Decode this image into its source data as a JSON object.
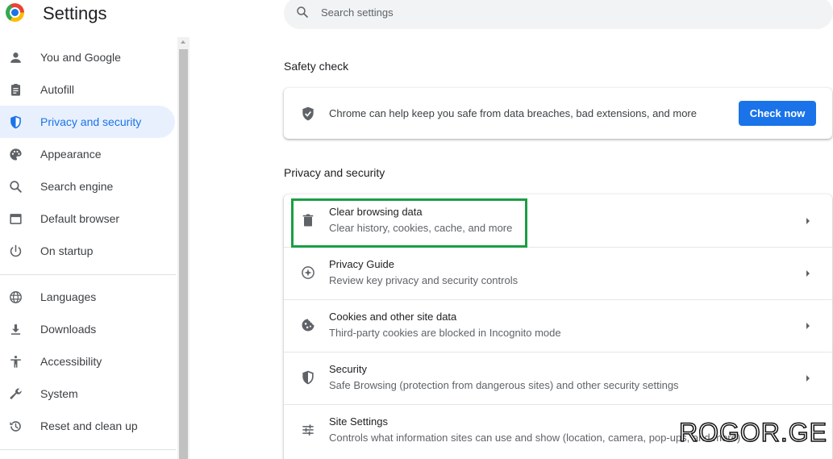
{
  "header": {
    "title": "Settings",
    "search_placeholder": "Search settings"
  },
  "sidebar": {
    "items": [
      {
        "label": "You and Google",
        "icon": "person-icon"
      },
      {
        "label": "Autofill",
        "icon": "clipboard-icon"
      },
      {
        "label": "Privacy and security",
        "icon": "shield-icon",
        "active": true
      },
      {
        "label": "Appearance",
        "icon": "palette-icon"
      },
      {
        "label": "Search engine",
        "icon": "search-icon"
      },
      {
        "label": "Default browser",
        "icon": "browser-window-icon"
      },
      {
        "label": "On startup",
        "icon": "power-icon"
      },
      {
        "label": "Languages",
        "icon": "globe-icon"
      },
      {
        "label": "Downloads",
        "icon": "download-icon"
      },
      {
        "label": "Accessibility",
        "icon": "accessibility-icon"
      },
      {
        "label": "System",
        "icon": "wrench-icon"
      },
      {
        "label": "Reset and clean up",
        "icon": "history-icon"
      }
    ]
  },
  "safety_check": {
    "heading": "Safety check",
    "text": "Chrome can help keep you safe from data breaches, bad extensions, and more",
    "button_label": "Check now"
  },
  "privacy": {
    "heading": "Privacy and security",
    "rows": [
      {
        "title": "Clear browsing data",
        "subtitle": "Clear history, cookies, cache, and more",
        "icon": "trash-icon"
      },
      {
        "title": "Privacy Guide",
        "subtitle": "Review key privacy and security controls",
        "icon": "compass-icon"
      },
      {
        "title": "Cookies and other site data",
        "subtitle": "Third-party cookies are blocked in Incognito mode",
        "icon": "cookie-icon"
      },
      {
        "title": "Security",
        "subtitle": "Safe Browsing (protection from dangerous sites) and other security settings",
        "icon": "shield-icon"
      },
      {
        "title": "Site Settings",
        "subtitle": "Controls what information sites can use and show (location, camera, pop-ups, and more)",
        "icon": "sliders-icon"
      }
    ]
  },
  "watermark": "ROGOR.GE",
  "colors": {
    "accent": "#1a73e8",
    "active_bg": "#e8f0fe",
    "highlight": "#1b9e43"
  }
}
